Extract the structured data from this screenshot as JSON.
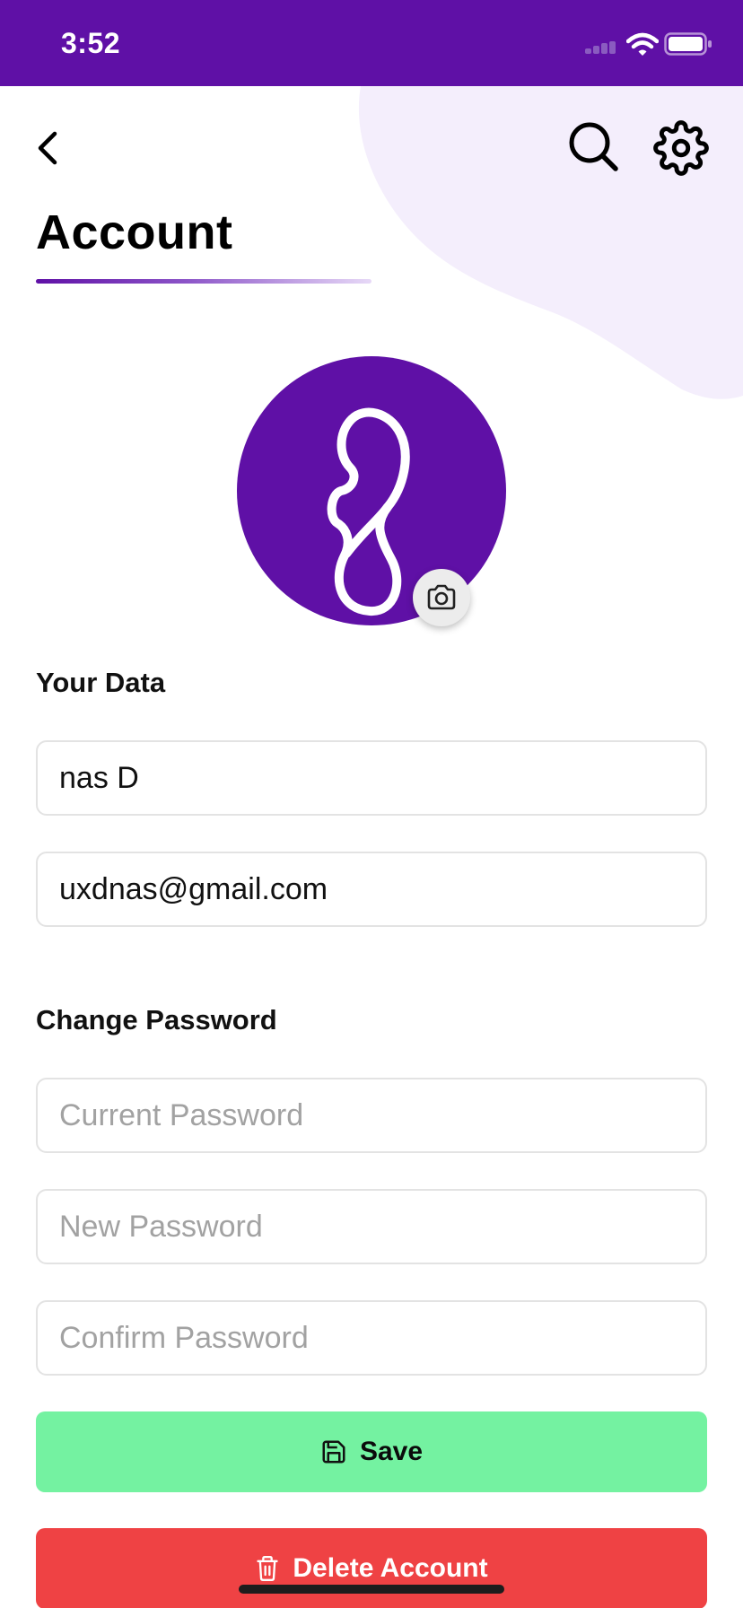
{
  "status_bar": {
    "time": "3:52",
    "icons": [
      "cellular-signal-icon",
      "wifi-icon",
      "battery-icon"
    ]
  },
  "nav": {
    "back_icon": "chevron-left-icon",
    "search_icon": "search-icon",
    "settings_icon": "gear-icon"
  },
  "page": {
    "title": "Account"
  },
  "avatar": {
    "logo_icon": "logo-8-icon",
    "camera_icon": "camera-icon"
  },
  "your_data": {
    "label": "Your Data",
    "name_value": "nas D",
    "email_value": "uxdnas@gmail.com"
  },
  "password": {
    "label": "Change Password",
    "current_placeholder": "Current Password",
    "new_placeholder": "New Password",
    "confirm_placeholder": "Confirm Password"
  },
  "actions": {
    "save_label": "Save",
    "save_icon": "floppy-disk-icon",
    "delete_label": "Delete Account",
    "delete_icon": "trash-icon"
  },
  "colors": {
    "primary": "#5f10a6",
    "blob": "#f4eefc",
    "save": "#74f2a1",
    "delete": "#ef4244"
  }
}
